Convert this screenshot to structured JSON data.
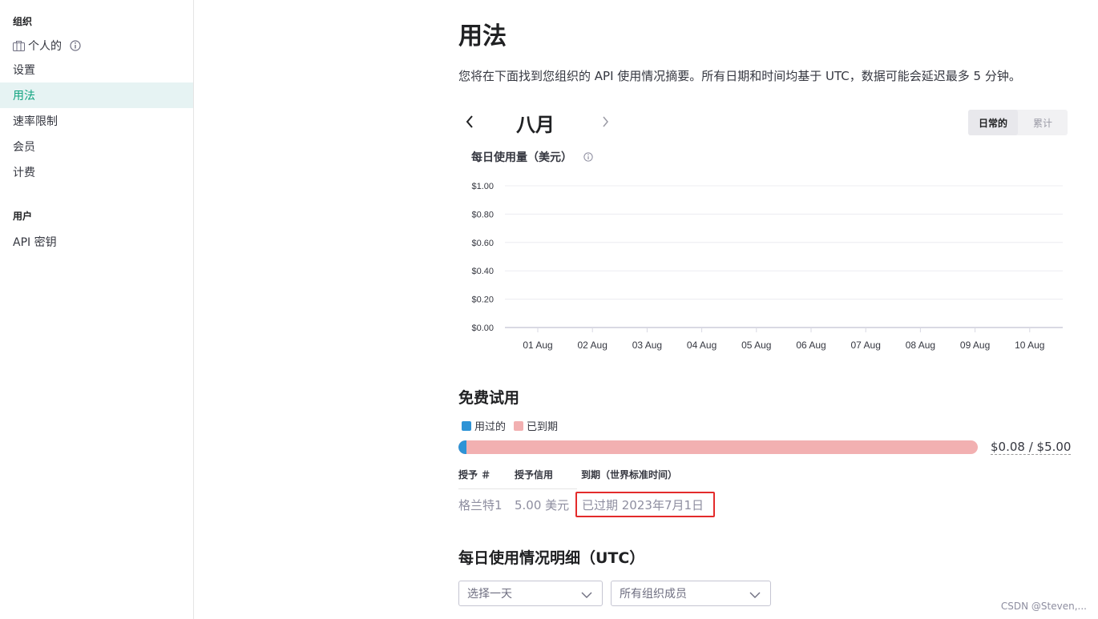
{
  "sidebar": {
    "org_section": "组织",
    "items": [
      {
        "label": "个人的"
      },
      {
        "label": "设置"
      },
      {
        "label": "用法"
      },
      {
        "label": "速率限制"
      },
      {
        "label": "会员"
      },
      {
        "label": "计费"
      }
    ],
    "user_section": "用户",
    "user_items": [
      {
        "label": "API 密钥"
      }
    ],
    "active_item": "用法"
  },
  "main": {
    "title": "用法",
    "description": "您将在下面找到您组织的 API 使用情况摘要。所有日期和时间均基于 UTC，数据可能会延迟最多 5 分钟。",
    "month": "八月",
    "view_toggle": {
      "daily": "日常的",
      "cumulative": "累计",
      "selected": "daily"
    }
  },
  "chart_data": {
    "type": "bar",
    "title": "每日使用量（美元）",
    "categories": [
      "01 Aug",
      "02 Aug",
      "03 Aug",
      "04 Aug",
      "05 Aug",
      "06 Aug",
      "07 Aug",
      "08 Aug",
      "09 Aug",
      "10 Aug"
    ],
    "values": [
      0,
      0,
      0,
      0,
      0,
      0,
      0,
      0,
      0,
      0
    ],
    "y_ticks": [
      "$0.00",
      "$0.20",
      "$0.40",
      "$0.60",
      "$0.80",
      "$1.00"
    ],
    "ylim": [
      0,
      1.0
    ],
    "grid": true
  },
  "free_trial": {
    "title": "免费试用",
    "legend_used": "用过的",
    "legend_expired": "已到期",
    "used": 0.08,
    "total": 5.0,
    "amount_label": "$0.08 / $5.00",
    "colors": {
      "used": "#2d93d6",
      "expired": "#f2b0b1"
    },
    "headers": {
      "grant": "授予 ＃",
      "credit": "授予信用",
      "expiry": "到期（世界标准时间）"
    },
    "row": {
      "grant": "格兰特1",
      "credit": "5.00 美元",
      "expiry": "已过期 2023年7月1日"
    }
  },
  "daily_detail": {
    "title": "每日使用情况明细（UTC）",
    "day_select_placeholder": "选择一天",
    "member_select_value": "所有组织成员"
  },
  "watermark": "CSDN @Steven,..."
}
